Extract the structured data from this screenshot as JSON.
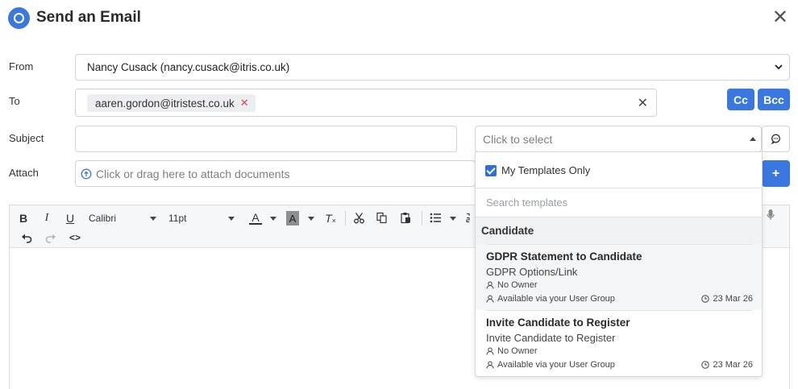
{
  "window": {
    "title": "Send an Email"
  },
  "labels": {
    "from": "From",
    "to": "To",
    "subject": "Subject",
    "attach": "Attach"
  },
  "from": {
    "value": "Nancy Cusack (nancy.cusack@itris.co.uk)"
  },
  "to": {
    "recipients": [
      "aaren.gordon@itristest.co.uk"
    ]
  },
  "buttons": {
    "cc": "Cc",
    "bcc": "Bcc",
    "add": "+"
  },
  "subject": {
    "value": "",
    "placeholder": ""
  },
  "template_select": {
    "placeholder": "Click to select"
  },
  "attach": {
    "placeholder": "Click or drag here to attach documents"
  },
  "editor": {
    "font_family": "Calibri",
    "font_size": "11pt",
    "body_text": ""
  },
  "template_dropdown": {
    "my_templates_only_label": "My Templates Only",
    "my_templates_only_checked": true,
    "search_placeholder": "Search templates",
    "group": "Candidate",
    "templates": [
      {
        "name": "GDPR Statement to Candidate",
        "description": "GDPR Options/Link",
        "owner": "No Owner",
        "availability": "Available via your User Group",
        "date": "23 Mar 26"
      },
      {
        "name": "Invite Candidate to Register",
        "description": "Invite Candidate to Register",
        "owner": "No Owner",
        "availability": "Available via your User Group",
        "date": "23 Mar 26"
      }
    ]
  },
  "icons": [
    "app-logo-icon",
    "close-icon",
    "chevron-down-icon",
    "remove-icon",
    "clear-icon",
    "chat-icon",
    "cloud-upload-icon",
    "bold-icon",
    "italic-icon",
    "underline-icon",
    "font-color-icon",
    "highlight-icon",
    "clear-format-icon",
    "cut-icon",
    "copy-icon",
    "paste-icon",
    "bullet-list-icon",
    "numbered-list-icon",
    "undo-icon",
    "redo-icon",
    "source-code-icon",
    "microphone-icon",
    "user-icon",
    "clock-icon"
  ],
  "colors": {
    "accent": "#3a78e0",
    "remove": "#e04545"
  }
}
